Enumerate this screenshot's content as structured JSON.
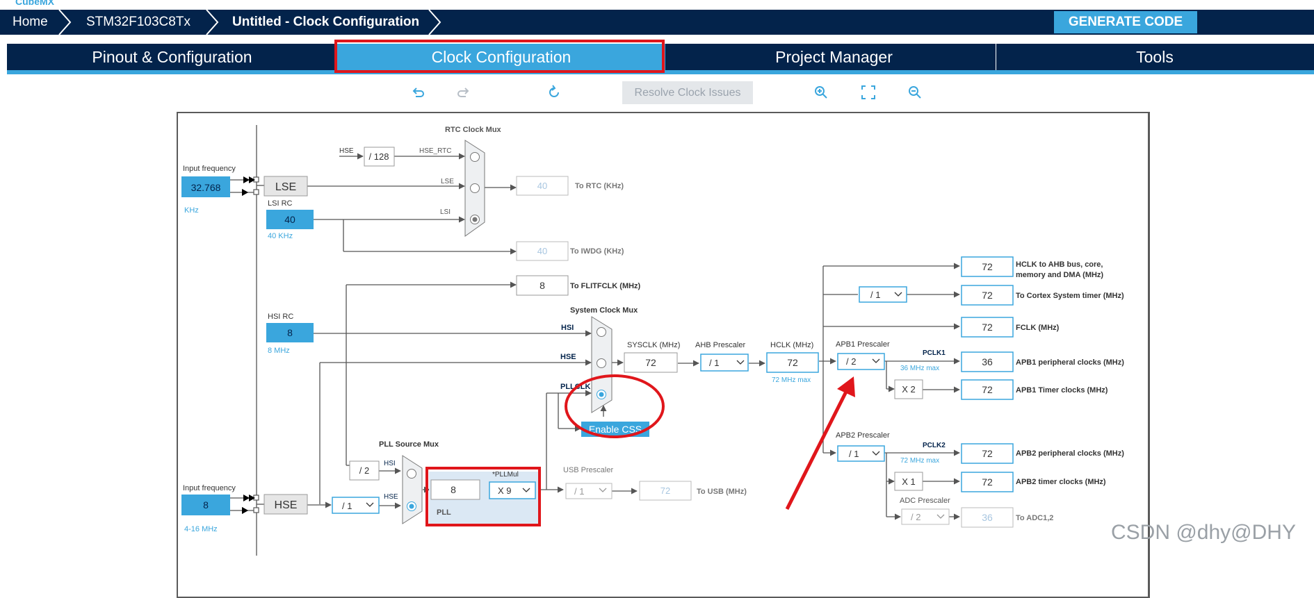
{
  "brand": {
    "logo_text": "CubeMX"
  },
  "breadcrumb": {
    "home": "Home",
    "mcu": "STM32F103C8Tx",
    "page": "Untitled - Clock Configuration"
  },
  "toolbar": {
    "generate_label": "GENERATE CODE",
    "resolve_label": "Resolve Clock Issues"
  },
  "tabs": [
    {
      "label": "Pinout & Configuration"
    },
    {
      "label": "Clock Configuration"
    },
    {
      "label": "Project Manager"
    },
    {
      "label": "Tools"
    }
  ],
  "diagram": {
    "rtc_mux_title": "RTC Clock Mux",
    "sys_mux_title": "System Clock Mux",
    "pll_src_mux_title": "PLL Source Mux",
    "input_freq_label": "Input frequency",
    "lse_value": "32.768",
    "lse_unit": "KHz",
    "lse_label": "LSE",
    "lsi_label": "LSI RC",
    "lsi_value": "40",
    "lsi_unit": "40 KHz",
    "hse_label_small": "HSE",
    "div128": "/ 128",
    "hse_rtc": "HSE_RTC",
    "lse_small": "LSE",
    "lsi_small": "LSI",
    "rtc_value": "40",
    "rtc_label": "To RTC (KHz)",
    "iwdg_value": "40",
    "iwdg_label": "To IWDG (KHz)",
    "flit_value": "8",
    "flit_label": "To FLITFCLK (MHz)",
    "hsi_label": "HSI RC",
    "hsi_value": "8",
    "hsi_unit": "8 MHz",
    "hsi_small": "HSI",
    "hse_small": "HSE",
    "pllclk_small": "PLLCLK",
    "enable_css": "Enable CSS",
    "sysclk_label": "SYSCLK (MHz)",
    "sysclk_value": "72",
    "ahb_label": "AHB Prescaler",
    "ahb_value": "/ 1",
    "hclk_label": "HCLK (MHz)",
    "hclk_value": "72",
    "hclk_max": "72 MHz max",
    "apb1_label": "APB1 Prescaler",
    "apb1_value": "/ 2",
    "pclk1_label": "PCLK1",
    "pclk1_max": "36 MHz max",
    "x2_label": "X 2",
    "apb2_label": "APB2 Prescaler",
    "apb2_value": "/ 1",
    "pclk2_label": "PCLK2",
    "pclk2_max": "72 MHz max",
    "x1_label": "X 1",
    "adc_label": "ADC Prescaler",
    "adc_value": "/ 2",
    "cortex_div": "/ 1",
    "outputs": [
      {
        "value": "72",
        "label": "HCLK to AHB bus, core,",
        "label2": "memory and DMA (MHz)"
      },
      {
        "value": "72",
        "label": "To Cortex System timer (MHz)"
      },
      {
        "value": "72",
        "label": "FCLK (MHz)"
      },
      {
        "value": "36",
        "label": "APB1 peripheral clocks (MHz)"
      },
      {
        "value": "72",
        "label": "APB1 Timer clocks (MHz)"
      },
      {
        "value": "72",
        "label": "APB2 peripheral clocks (MHz)"
      },
      {
        "value": "72",
        "label": "APB2 timer clocks (MHz)"
      },
      {
        "value": "36",
        "label": "To ADC1,2"
      }
    ],
    "hse_input_label": "Input frequency",
    "hse_input_value": "8",
    "hse_input_unit": "4-16 MHz",
    "hse_label": "HSE",
    "hse_div": "/ 1",
    "div2": "/ 2",
    "pll_value": "8",
    "pll_mul_label": "*PLLMul",
    "pll_mul_value": "X 9",
    "pll_label": "PLL",
    "usb_label": "USB Prescaler",
    "usb_div": "/ 1",
    "usb_value": "72",
    "usb_to": "To USB (MHz)"
  },
  "watermark": "CSDN @dhy@DHY",
  "colors": {
    "navy": "#03234b",
    "accent": "#3aa6dd",
    "annotation_red": "#e0161b"
  }
}
